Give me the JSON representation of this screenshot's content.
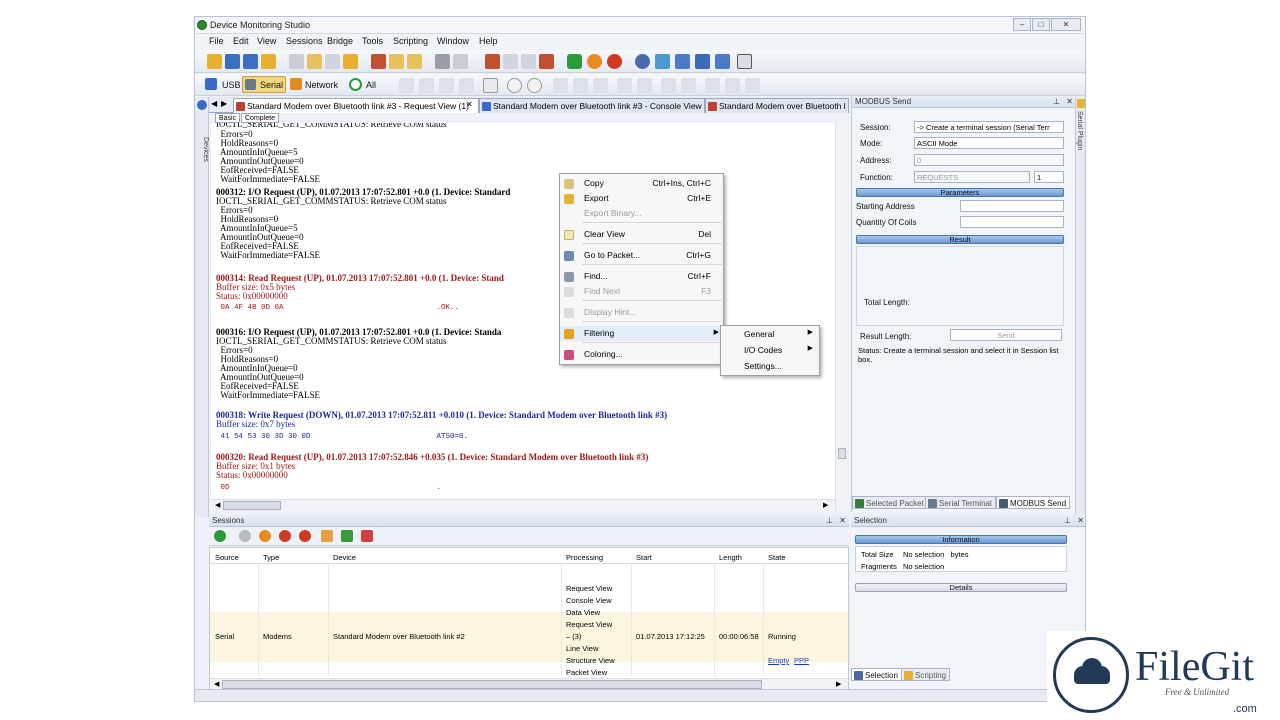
{
  "window": {
    "title": "Device Monitoring Studio"
  },
  "menu": [
    "File",
    "Edit",
    "View",
    "Sessions",
    "Bridge",
    "Tools",
    "Scripting",
    "Window",
    "Help"
  ],
  "toolbar2": {
    "usb": "USB",
    "serial": "Serial",
    "network": "Network",
    "all": "All"
  },
  "doc_tabs": [
    "Standard Modem over Bluetooth link #3 - Request View (1)",
    "Standard Modem over Bluetooth link #3 - Console View",
    "Standard Modem over Bluetooth l"
  ],
  "sub_tabs": [
    "Basic",
    "Complete"
  ],
  "left_strip_label": "Devices",
  "log": [
    {
      "t": "IOCTL_SERIAL_GET_COMMSTATUS: Retrieve COM status",
      "c": "n"
    },
    {
      "t": "  Errors=0",
      "c": "n"
    },
    {
      "t": "  HoldReasons=0",
      "c": "n"
    },
    {
      "t": "  AmountInInQueue=5",
      "c": "n"
    },
    {
      "t": "  AmountInOutQueue=0",
      "c": "n"
    },
    {
      "t": "  EofReceived=FALSE",
      "c": "n"
    },
    {
      "t": "  WaitForImmediate=FALSE",
      "c": "n"
    },
    {
      "t": "000312: I/O Request (UP), 01.07.2013 17:07:52.801 +0.0 (1. Device: Standard",
      "c": "h"
    },
    {
      "t": "IOCTL_SERIAL_GET_COMMSTATUS: Retrieve COM status",
      "c": "n"
    },
    {
      "t": "  Errors=0",
      "c": "n"
    },
    {
      "t": "  HoldReasons=0",
      "c": "n"
    },
    {
      "t": "  AmountInInQueue=5",
      "c": "n"
    },
    {
      "t": "  AmountInOutQueue=0",
      "c": "n"
    },
    {
      "t": "  EofReceived=FALSE",
      "c": "n"
    },
    {
      "t": "  WaitForImmediate=FALSE",
      "c": "n"
    },
    {
      "t": "000314: Read Request (UP), 01.07.2013 17:07:52.801 +0.0 (1. Device: Stand",
      "c": "rh"
    },
    {
      "t": "Buffer size: 0x5 bytes",
      "c": "r"
    },
    {
      "t": "Status: 0x00000000",
      "c": "r"
    },
    {
      "t": " 0A 4F 4B 0D 0A                                  .OK..",
      "c": "rm"
    },
    {
      "t": "000316: I/O Request (UP), 01.07.2013 17:07:52.801 +0.0 (1. Device: Standa",
      "c": "h"
    },
    {
      "t": "IOCTL_SERIAL_GET_COMMSTATUS: Retrieve COM status",
      "c": "n"
    },
    {
      "t": "  Errors=0",
      "c": "n"
    },
    {
      "t": "  HoldReasons=0",
      "c": "n"
    },
    {
      "t": "  AmountInInQueue=0",
      "c": "n"
    },
    {
      "t": "  AmountInOutQueue=0",
      "c": "n"
    },
    {
      "t": "  EofReceived=FALSE",
      "c": "n"
    },
    {
      "t": "  WaitForImmediate=FALSE",
      "c": "n"
    },
    {
      "t": "000318: Write Request (DOWN), 01.07.2013 17:07:52.811 +0.010 (1. Device: Standard Modem over Bluetooth link #3)",
      "c": "bh"
    },
    {
      "t": "Buffer size: 0x7 bytes",
      "c": "b"
    },
    {
      "t": " 41 54 53 30 3D 30 0D                            ATS0=0.",
      "c": "bm"
    },
    {
      "t": "000320: Read Request (UP), 01.07.2013 17:07:52.846 +0.035 (1. Device: Standard Modem over Bluetooth link #3)",
      "c": "rh"
    },
    {
      "t": "Buffer size: 0x1 bytes",
      "c": "r"
    },
    {
      "t": "Status: 0x00000000",
      "c": "r"
    },
    {
      "t": " 0D                                              .",
      "c": "rm"
    }
  ],
  "context_menu": [
    {
      "label": "Copy",
      "shortcut": "Ctrl+Ins, Ctrl+C",
      "disabled": false
    },
    {
      "label": "Export",
      "shortcut": "Ctrl+E",
      "disabled": false
    },
    {
      "label": "Export Binary...",
      "shortcut": "",
      "disabled": true
    },
    {
      "label": "Clear View",
      "shortcut": "Del",
      "disabled": false
    },
    {
      "label": "Go to Packet...",
      "shortcut": "Ctrl+G",
      "disabled": false
    },
    {
      "label": "Find...",
      "shortcut": "Ctrl+F",
      "disabled": false
    },
    {
      "label": "Find Next",
      "shortcut": "F3",
      "disabled": true
    },
    {
      "label": "Display Hint...",
      "shortcut": "",
      "disabled": true
    },
    {
      "label": "Filtering",
      "shortcut": "",
      "disabled": false
    },
    {
      "label": "Coloring...",
      "shortcut": "",
      "disabled": false
    }
  ],
  "filtering_submenu": [
    "General",
    "I/O Codes",
    "Settings..."
  ],
  "modbus": {
    "header": "MODBUS Send",
    "session_label": "Session:",
    "session_value": "-> Create a terminal session (Serial Terr",
    "mode_label": "Mode:",
    "mode_value": "ASCII Mode",
    "address_label": "Address:",
    "address_value": "0",
    "function_label": "Function:",
    "function_value": "REQUESTS",
    "function_count": "1",
    "parameters": "Parameters",
    "starting_address": "Starting Address",
    "quantity_of_coils": "Quantity Of Coils",
    "result": "Result",
    "total_length": "Total Length:",
    "result_length": "Result Length:",
    "send": "Send",
    "status": "Status: Create a terminal session and select it in Session list box.",
    "tabs": [
      "Selected Packet",
      "Serial Terminal",
      "MODBUS Send"
    ],
    "side_label": "Serial Plugin"
  },
  "sessions": {
    "header": "Sessions",
    "columns": [
      "Source",
      "Type",
      "Device",
      "Processing",
      "Start",
      "Length",
      "State"
    ],
    "processing_items": [
      "Request View",
      "Console View",
      "Data View",
      "Request View",
      "– (3)",
      "Line View",
      "Structure View",
      "Packet View"
    ],
    "row": {
      "source": "Serial",
      "type": "Modems",
      "device": "Standard Modem over Bluetooth link #2",
      "start": "01.07.2013 17:12:25",
      "length": "00:00:06:58",
      "state": "Running"
    },
    "links": [
      "Empty",
      "PPP"
    ]
  },
  "selection": {
    "header": "Selection",
    "information": "Information",
    "total_size_label": "Total Size",
    "total_size_value": "No selection   bytes",
    "fragments_label": "Fragments",
    "fragments_value": "No selection",
    "details": "Details",
    "tabs": [
      "Selection",
      "Scripting"
    ]
  },
  "watermark": {
    "brand": "FileGit",
    "tagline": "Free & Unlimited",
    "domain": ".com"
  },
  "colors": {
    "accent": "#6b98d2",
    "highlight_row": "#fdf6df",
    "red_log": "#a01818",
    "blue_log": "#1c2a9c"
  }
}
